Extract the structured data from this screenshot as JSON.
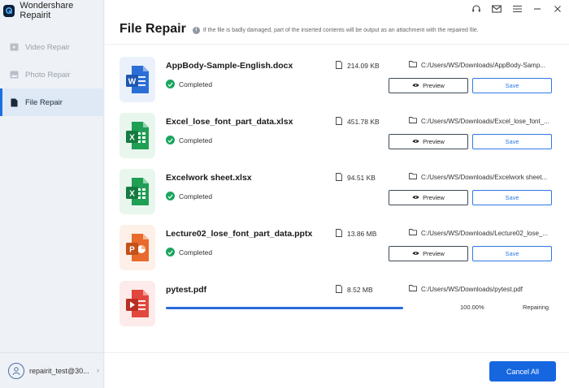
{
  "app": {
    "title": "Wondershare Repairit"
  },
  "sidebar": {
    "items": [
      {
        "label": "Video Repair",
        "icon": "video-icon"
      },
      {
        "label": "Photo Repair",
        "icon": "photo-icon"
      },
      {
        "label": "File Repair",
        "icon": "file-icon",
        "active": true
      }
    ],
    "account": "repairit_test@30..."
  },
  "header": {
    "title": "File Repair",
    "hint": "If the file is badly damaged, part of the inserted contents will be output as an attachment with the repaired file."
  },
  "files": [
    {
      "name": "AppBody-Sample-English.docx",
      "status": "Completed",
      "size": "214.09  KB",
      "path": "C:/Users/WS/Downloads/AppBody-Samp...",
      "type": "word",
      "preview_label": "Preview",
      "save_label": "Save"
    },
    {
      "name": "Excel_lose_font_part_data.xlsx",
      "status": "Completed",
      "size": "451.78  KB",
      "path": "C:/Users/WS/Downloads/Excel_lose_font_...",
      "type": "excel",
      "preview_label": "Preview",
      "save_label": "Save"
    },
    {
      "name": "Excelwork sheet.xlsx",
      "status": "Completed",
      "size": "94.51  KB",
      "path": "C:/Users/WS/Downloads/Excelwork sheet...",
      "type": "excel",
      "preview_label": "Preview",
      "save_label": "Save"
    },
    {
      "name": "Lecture02_lose_font_part_data.pptx",
      "status": "Completed",
      "size": "13.86  MB",
      "path": "C:/Users/WS/Downloads/Lecture02_lose_...",
      "type": "powerpoint",
      "preview_label": "Preview",
      "save_label": "Save"
    },
    {
      "name": "pytest.pdf",
      "status": "Repairing",
      "size": "8.52  MB",
      "path": "C:/Users/WS/Downloads/pytest.pdf",
      "type": "pdf",
      "progress": 1.0,
      "progress_text": "100.00%"
    }
  ],
  "footer": {
    "cancel_all_label": "Cancel All"
  },
  "colors": {
    "accent": "#1666e0",
    "success": "#1ba55f",
    "word": "#2b6fd6",
    "excel": "#1f9e54",
    "powerpoint": "#e86a2c",
    "pdf": "#e2483d"
  }
}
